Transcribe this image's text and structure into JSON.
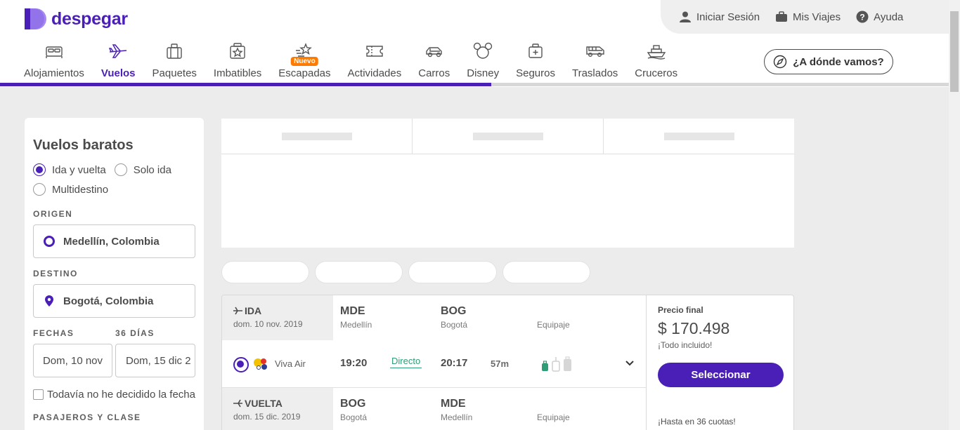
{
  "brand": {
    "name": "despegar",
    "color": "#4a1fb8"
  },
  "user_menu": {
    "login": "Iniciar Sesión",
    "trips": "Mis Viajes",
    "help": "Ayuda"
  },
  "nav": {
    "items": [
      {
        "label": "Alojamientos",
        "icon": "bed-icon"
      },
      {
        "label": "Vuelos",
        "icon": "plane-icon",
        "active": true
      },
      {
        "label": "Paquetes",
        "icon": "suitcase-icon"
      },
      {
        "label": "Imbatibles",
        "icon": "star-badge-icon"
      },
      {
        "label": "Escapadas",
        "icon": "star-escape-icon",
        "badge": "Nuevo"
      },
      {
        "label": "Actividades",
        "icon": "ticket-icon"
      },
      {
        "label": "Carros",
        "icon": "car-icon"
      },
      {
        "label": "Disney",
        "icon": "mickey-icon"
      },
      {
        "label": "Seguros",
        "icon": "medkit-icon"
      },
      {
        "label": "Traslados",
        "icon": "bus-icon"
      },
      {
        "label": "Cruceros",
        "icon": "ship-icon"
      }
    ],
    "progress_fraction": 0.518,
    "where_button": "¿A dónde vamos?"
  },
  "search": {
    "title": "Vuelos baratos",
    "trip_types": [
      "Ida y vuelta",
      "Solo ida",
      "Multidestino"
    ],
    "selected_trip_type": "Ida y vuelta",
    "origin_label": "ORIGEN",
    "origin_value": "Medellín, Colombia",
    "destination_label": "DESTINO",
    "destination_value": "Bogotá, Colombia",
    "dates_label": "FECHAS",
    "days_label": "36 DÍAS",
    "date_from": "Dom, 10 nov",
    "date_to": "Dom, 15 dic 2",
    "undecided_label": "Todavía no he decidido la fecha",
    "passengers_label": "PASAJEROS Y CLASE"
  },
  "result": {
    "outbound": {
      "tab_label": "IDA",
      "date": "dom. 10 nov. 2019",
      "origin_code": "MDE",
      "origin_city": "Medellín",
      "dest_code": "BOG",
      "dest_city": "Bogotá",
      "baggage_label": "Equipaje",
      "airline": "Viva Air",
      "depart_time": "19:20",
      "stops": "Directo",
      "arrive_time": "20:17",
      "duration": "57m"
    },
    "return": {
      "tab_label": "VUELTA",
      "date": "dom. 15 dic. 2019",
      "origin_code": "BOG",
      "origin_city": "Bogotá",
      "dest_code": "MDE",
      "dest_city": "Medellín",
      "baggage_label": "Equipaje"
    },
    "price": {
      "label": "Precio final",
      "value": "$ 170.498",
      "included": "¡Todo incluido!",
      "button": "Seleccionar",
      "installments": "¡Hasta en 36 cuotas!"
    }
  }
}
